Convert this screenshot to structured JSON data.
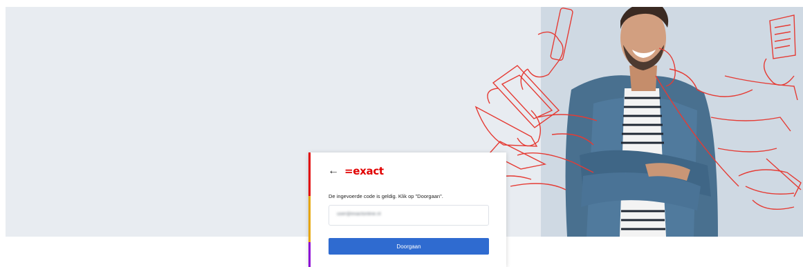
{
  "brand": {
    "logo_text": "=exact",
    "accent_color": "#e10000"
  },
  "login": {
    "back_icon": "arrow-left-icon",
    "message": "De ingevoerde code is geldig. Klik op \"Doorgaan\".",
    "email_value": "user@exactonline.nl",
    "continue_label": "Doorgaan",
    "button_color": "#2f6bd0"
  },
  "hero": {
    "background_color": "#e8ecf1",
    "illustration": "smiling-man-with-many-hands-illustration"
  }
}
